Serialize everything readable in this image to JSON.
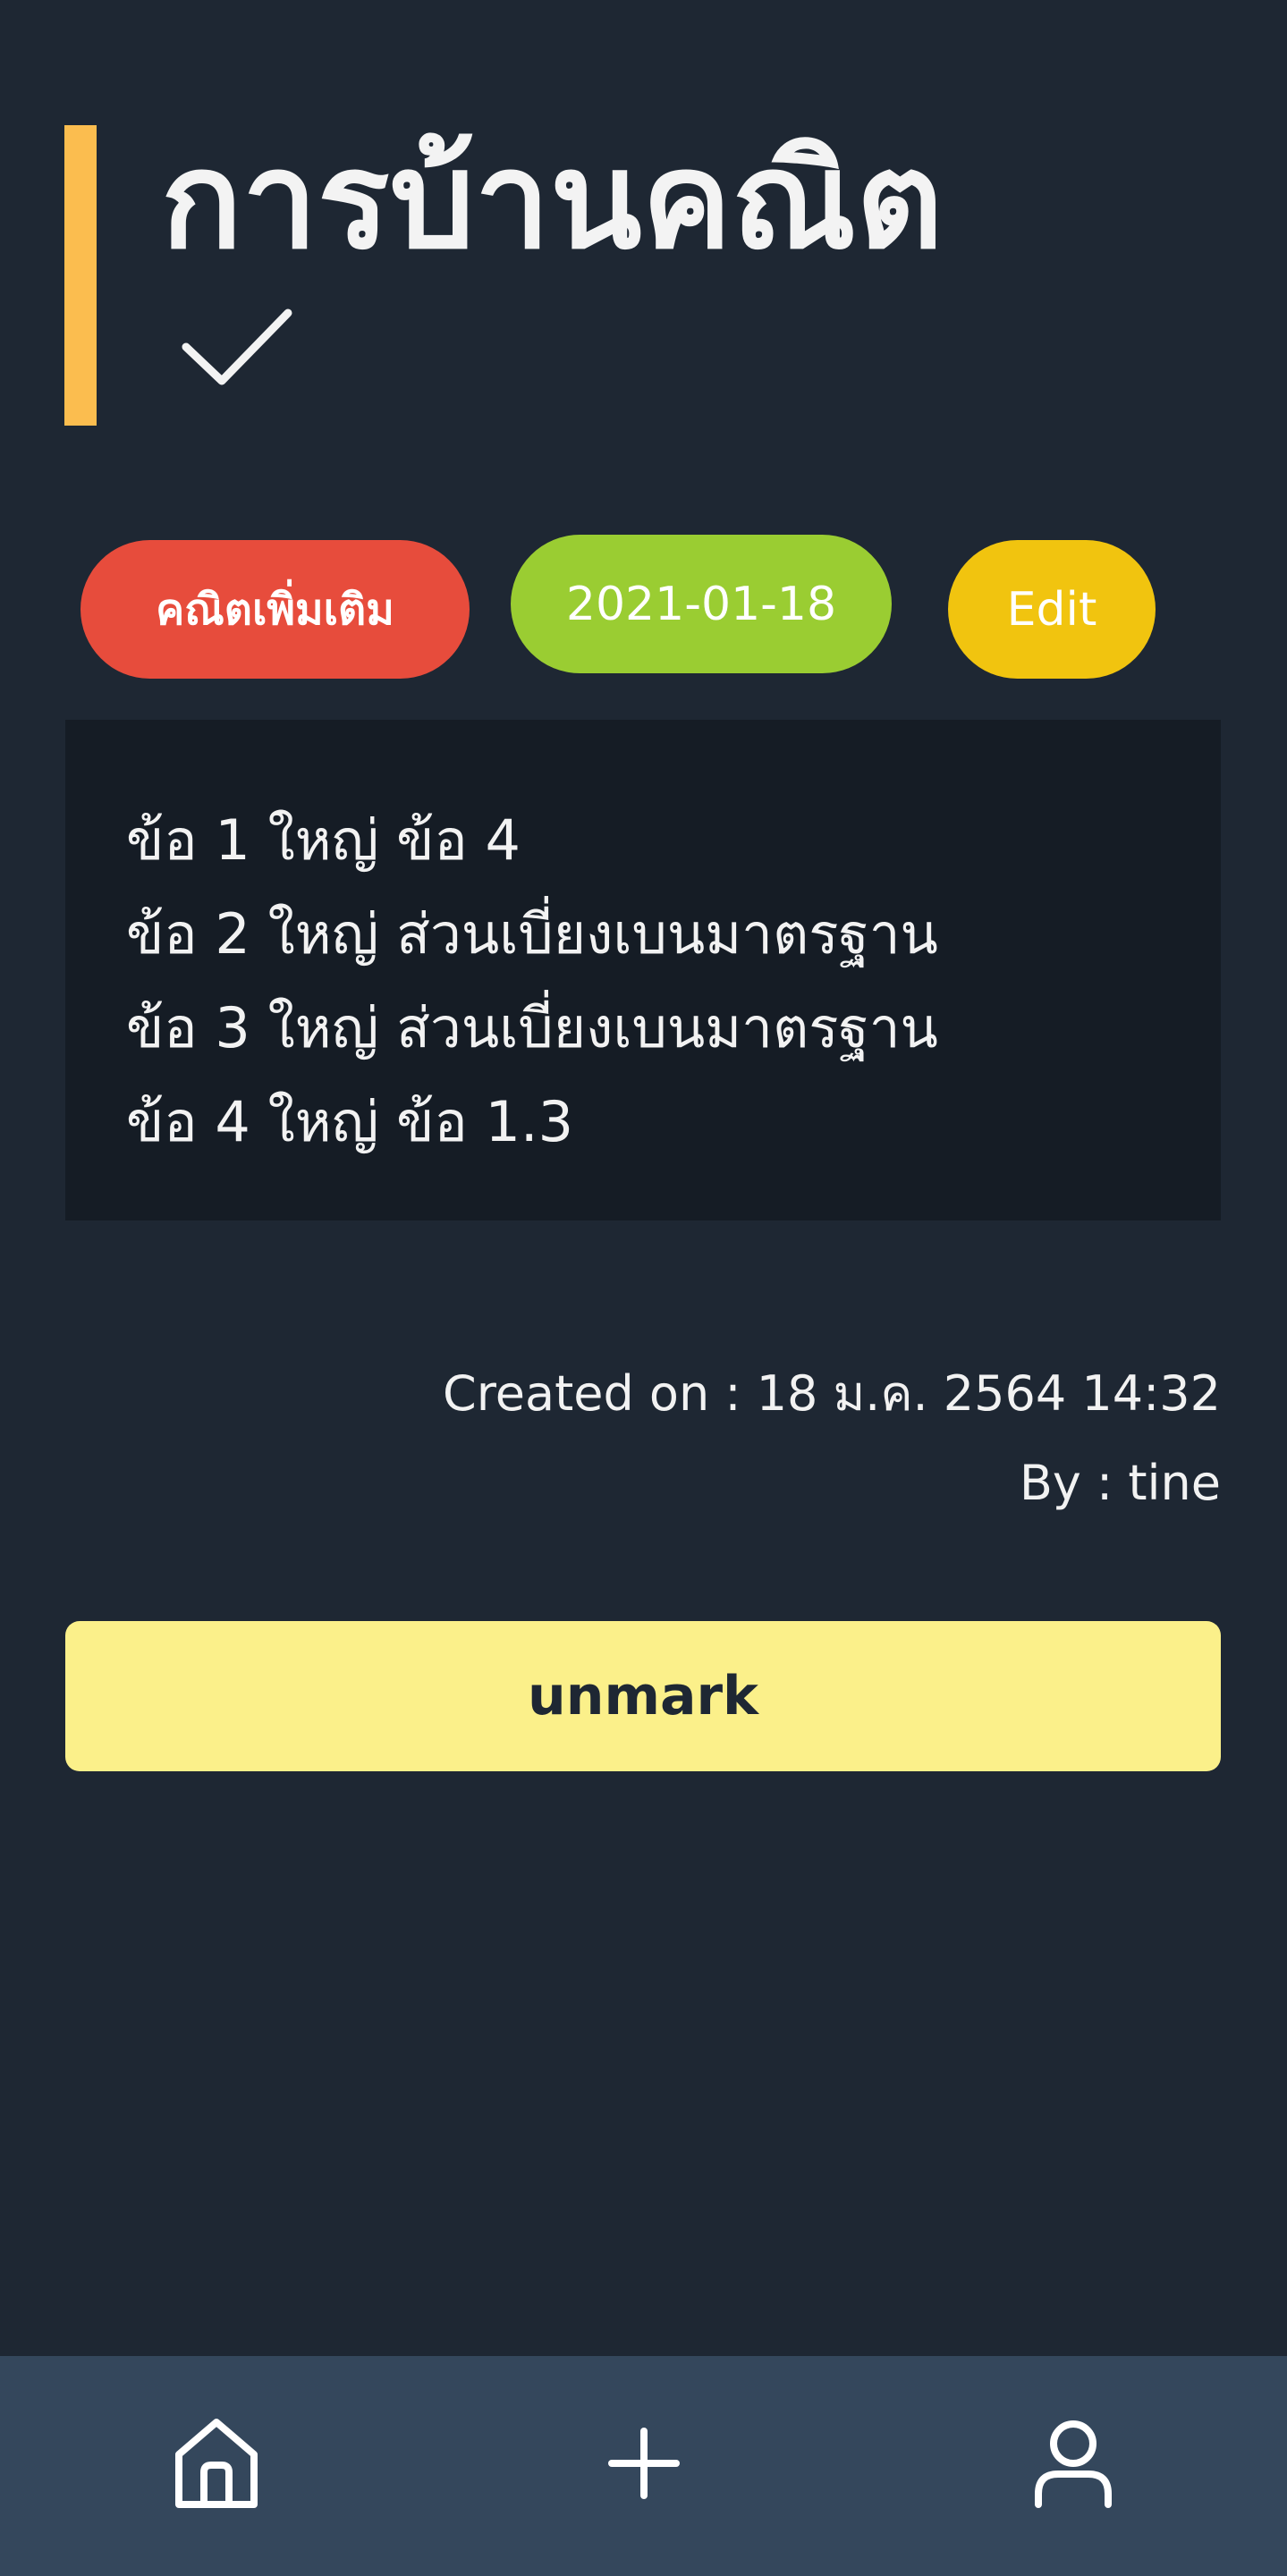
{
  "header": {
    "title": "การบ้านคณิต",
    "accent_color": "#fbbd4f",
    "status_icon": "checkmark-icon"
  },
  "tags": {
    "category": {
      "label": "คณิตเพิ่มเติม",
      "color": "#e74c3c"
    },
    "date": {
      "label": "2021-01-18",
      "color": "#9acd32"
    },
    "edit": {
      "label": "Edit",
      "color": "#f1c40f"
    }
  },
  "content": {
    "lines": [
      "ข้อ 1 ใหญ่ ข้อ 4",
      "ข้อ 2 ใหญ่ ส่วนเบี่ยงเบนมาตรฐาน",
      "ข้อ 3 ใหญ่ ส่วนเบี่ยงเบนมาตรฐาน",
      "ข้อ 4 ใหญ่ ข้อ 1.3"
    ]
  },
  "meta": {
    "created": "Created on : 18 ม.ค. 2564 14:32",
    "by": "By : tine"
  },
  "actions": {
    "unmark_label": "unmark",
    "unmark_color": "#fbf08a"
  },
  "bottom_nav": {
    "items": [
      {
        "icon": "home-icon"
      },
      {
        "icon": "plus-icon"
      },
      {
        "icon": "user-icon"
      }
    ],
    "background": "#34475c"
  }
}
